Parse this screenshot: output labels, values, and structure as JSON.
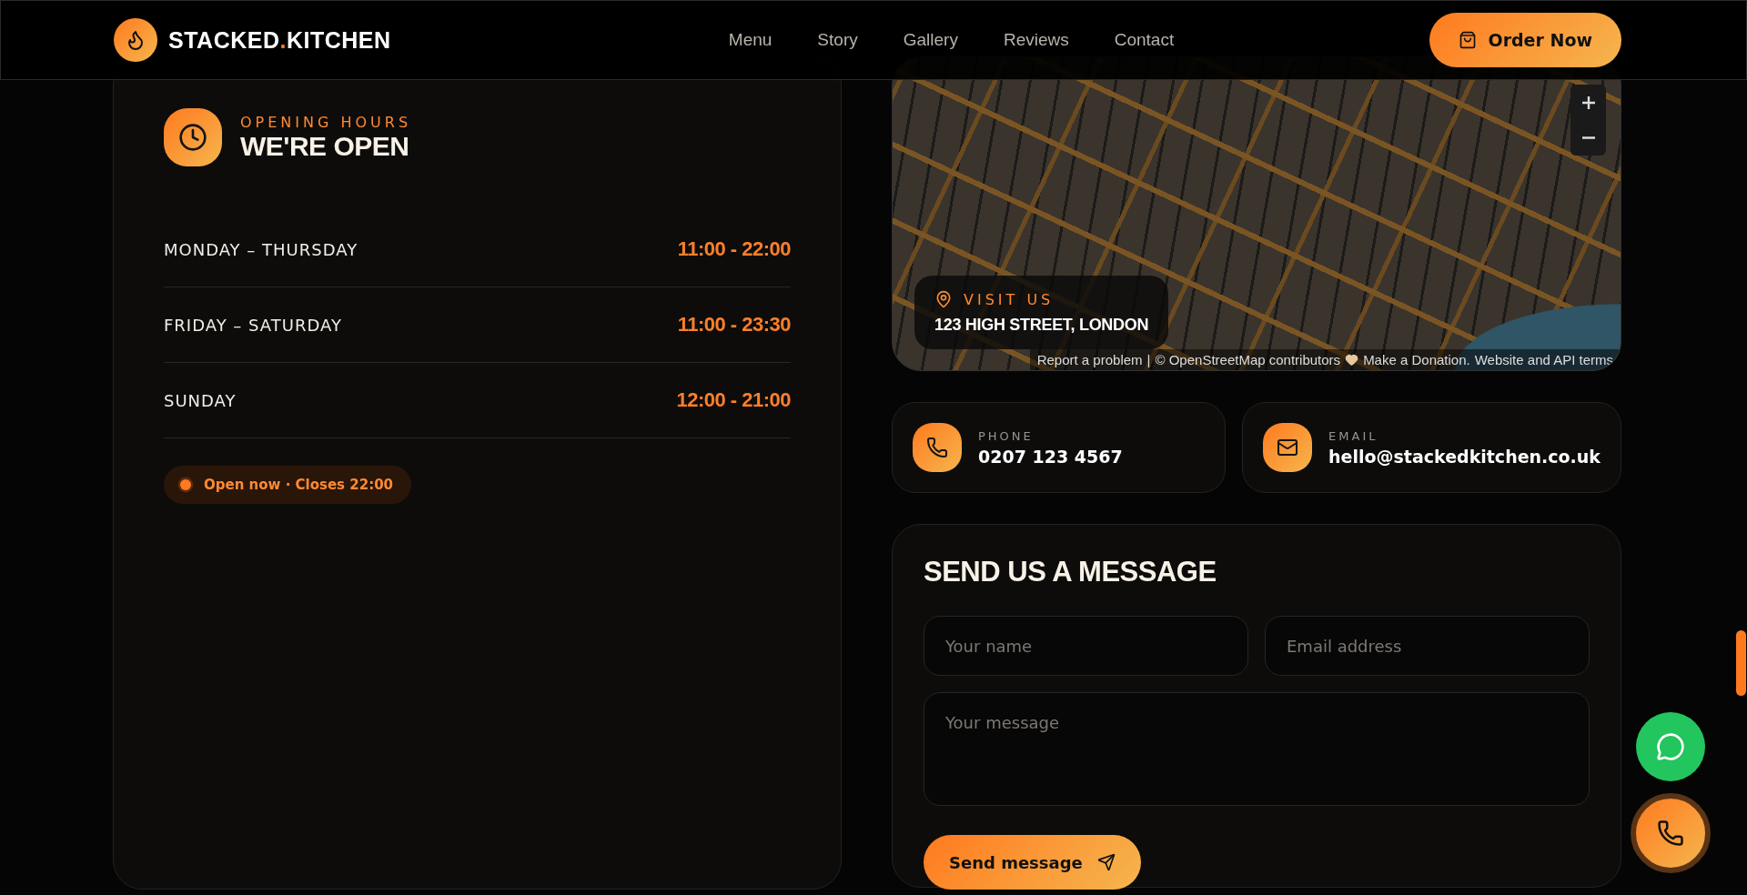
{
  "header": {
    "logo": {
      "text_before": "STACKED",
      "dot": ".",
      "text_after": "KITCHEN"
    },
    "nav": [
      "Menu",
      "Story",
      "Gallery",
      "Reviews",
      "Contact"
    ],
    "order_button": "Order Now"
  },
  "hours": {
    "eyebrow": "OPENING HOURS",
    "title": "WE'RE OPEN",
    "rows": [
      {
        "days": "MONDAY – THURSDAY",
        "time": "11:00 - 22:00"
      },
      {
        "days": "FRIDAY – SATURDAY",
        "time": "11:00 - 23:30"
      },
      {
        "days": "SUNDAY",
        "time": "12:00 - 21:00"
      }
    ],
    "status": {
      "text": "Open now · Closes 22:00",
      "open": true
    }
  },
  "map": {
    "visit_label": "VISIT US",
    "address": "123 HIGH STREET, LONDON",
    "attribution": [
      "Report a problem",
      "|",
      "© OpenStreetMap contributors",
      "Make a Donation.",
      "Website and API terms"
    ]
  },
  "contacts": [
    {
      "kind": "phone",
      "label": "PHONE",
      "value": "0207 123 4567"
    },
    {
      "kind": "email",
      "label": "EMAIL",
      "value": "hello@stackedkitchen.co.uk"
    }
  ],
  "form": {
    "title": "SEND US A MESSAGE",
    "name_placeholder": "Your name",
    "email_placeholder": "Email address",
    "message_placeholder": "Your message",
    "submit": "Send message"
  }
}
